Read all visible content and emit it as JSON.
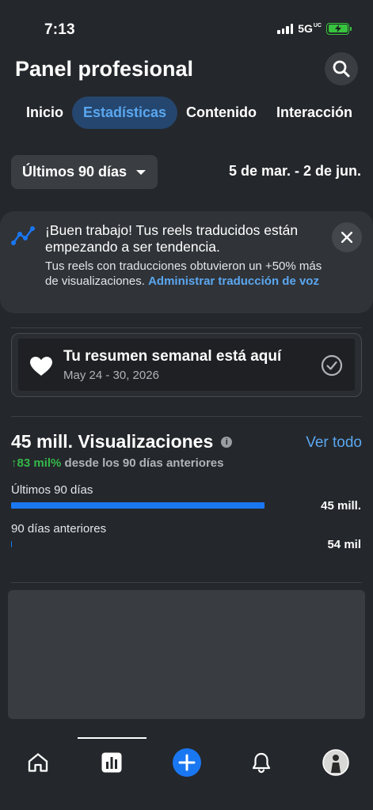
{
  "status_bar": {
    "time": "7:13",
    "network": "5G",
    "network_sup": "UC"
  },
  "header": {
    "title": "Panel profesional"
  },
  "tabs": [
    {
      "label": "Inicio",
      "active": false
    },
    {
      "label": "Estadísticas",
      "active": true
    },
    {
      "label": "Contenido",
      "active": false
    },
    {
      "label": "Interacción",
      "active": false
    }
  ],
  "filter": {
    "selected": "Últimos 90 días",
    "date_range": "5 de mar. - 2 de jun."
  },
  "banner": {
    "title": "¡Buen trabajo! Tus reels traducidos están empezando a ser tendencia.",
    "body": "Tus reels con traducciones obtuvieron un +50% más de visualizaciones.",
    "link": "Administrar traducción de voz"
  },
  "weekly": {
    "title": "Tu resumen semanal está aquí",
    "dates": "May 24 - 30, 2026"
  },
  "stats": {
    "title": "45 mill. Visualizaciones",
    "see_all": "Ver todo",
    "change": "↑83 mil%",
    "change_suffix": "desde los 90 días anteriores",
    "current": {
      "label": "Últimos 90 días",
      "value": "45 mill.",
      "fraction": 1.0
    },
    "previous": {
      "label": "90 días anteriores",
      "value": "54 mil",
      "fraction": 0.0012
    }
  },
  "colors": {
    "accent": "#1a77f2",
    "link": "#5aa7f0",
    "positive": "#35b74a",
    "background": "#24272b"
  },
  "bottom_nav": [
    {
      "icon": "home-icon",
      "active": false
    },
    {
      "icon": "stats-icon",
      "active": true
    },
    {
      "icon": "create-plus-icon",
      "active": false
    },
    {
      "icon": "notifications-bell-icon",
      "active": false
    },
    {
      "icon": "profile-avatar",
      "active": false
    }
  ]
}
